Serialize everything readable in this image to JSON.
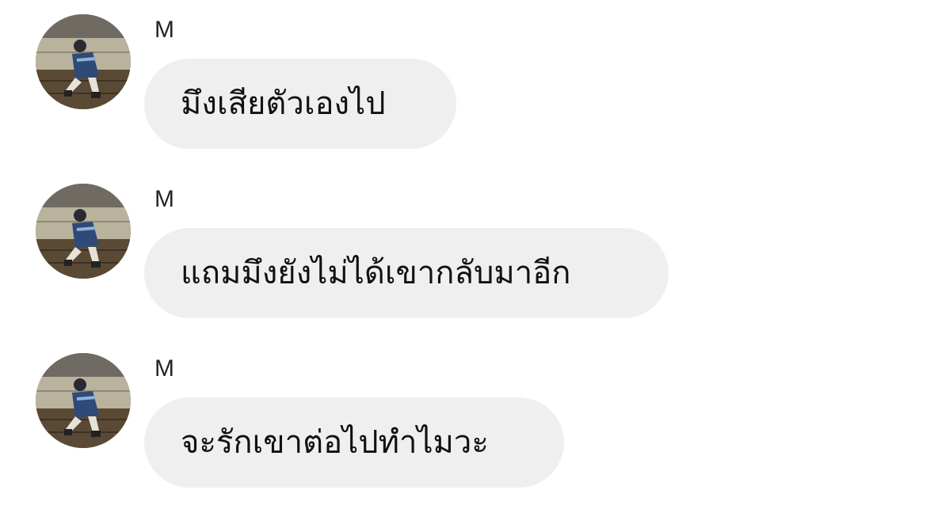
{
  "messages": [
    {
      "sender": "M",
      "avatar_icon": "profile-photo",
      "text": "มึงเสียตัวเองไป"
    },
    {
      "sender": "M",
      "avatar_icon": "profile-photo",
      "text": "แถมมึงยังไม่ได้เขากลับมาอีก"
    },
    {
      "sender": "M",
      "avatar_icon": "profile-photo",
      "text": "จะรักเขาต่อไปทำไมวะ"
    }
  ],
  "colors": {
    "background": "#ffffff",
    "bubble": "#efefef",
    "text": "#111111",
    "sender": "#262626"
  }
}
